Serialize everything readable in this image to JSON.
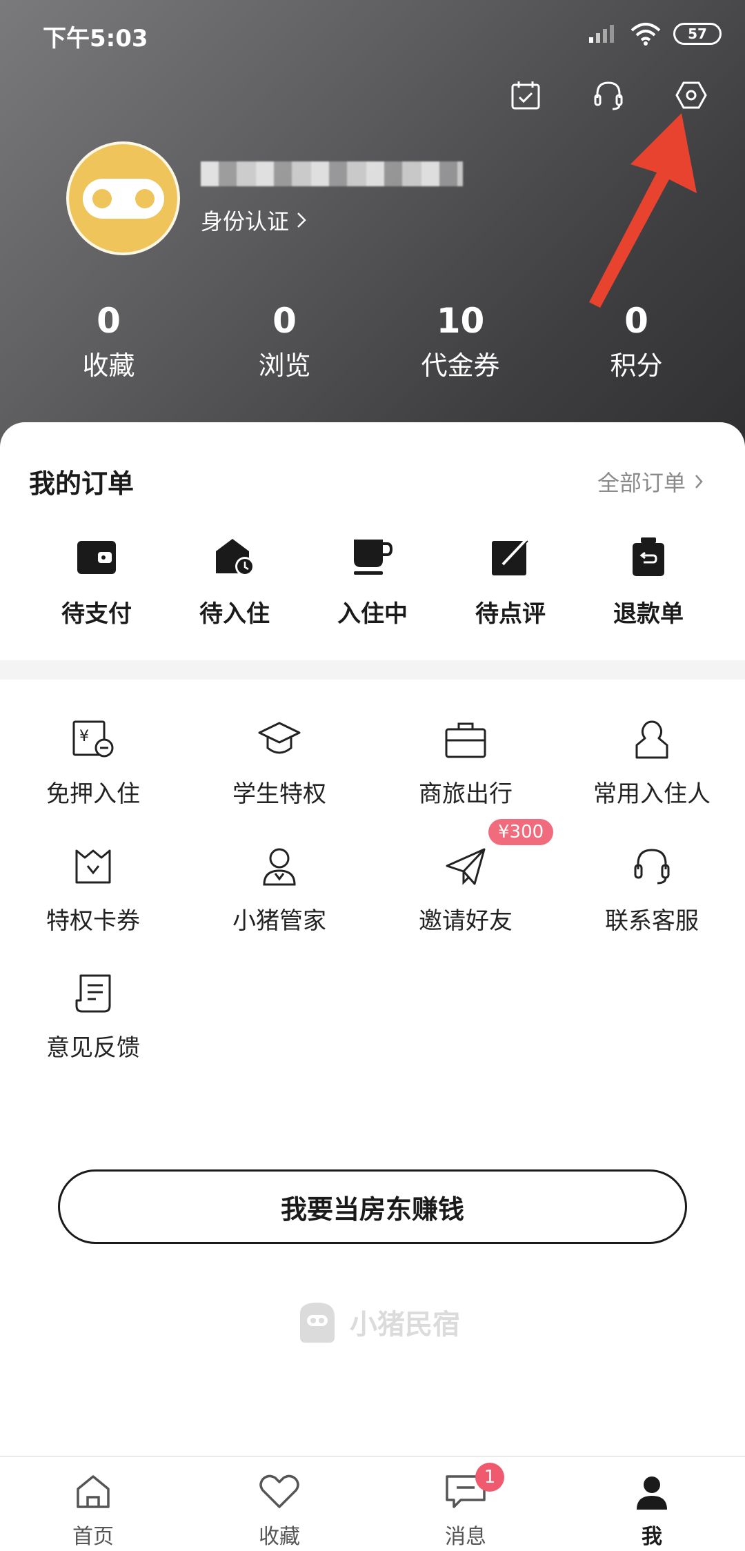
{
  "status_bar": {
    "time": "下午5:03",
    "battery": "57"
  },
  "header": {
    "verify_label": "身份认证",
    "stats": [
      {
        "value": "0",
        "label": "收藏"
      },
      {
        "value": "0",
        "label": "浏览"
      },
      {
        "value": "10",
        "label": "代金券"
      },
      {
        "value": "0",
        "label": "积分"
      }
    ]
  },
  "orders": {
    "title": "我的订单",
    "all_label": "全部订单",
    "items": [
      {
        "label": "待支付",
        "icon": "wallet-icon"
      },
      {
        "label": "待入住",
        "icon": "house-clock-icon"
      },
      {
        "label": "入住中",
        "icon": "cup-icon"
      },
      {
        "label": "待点评",
        "icon": "edit-icon"
      },
      {
        "label": "退款单",
        "icon": "refund-icon"
      }
    ]
  },
  "services": {
    "items": [
      {
        "label": "免押入住",
        "icon": "deposit-free-icon"
      },
      {
        "label": "学生特权",
        "icon": "graduation-cap-icon"
      },
      {
        "label": "商旅出行",
        "icon": "briefcase-icon"
      },
      {
        "label": "常用入住人",
        "icon": "person-icon"
      },
      {
        "label": "特权卡券",
        "icon": "crown-card-icon"
      },
      {
        "label": "小猪管家",
        "icon": "butler-icon"
      },
      {
        "label": "邀请好友",
        "icon": "paper-plane-icon",
        "badge": "¥300"
      },
      {
        "label": "联系客服",
        "icon": "headset-icon"
      },
      {
        "label": "意见反馈",
        "icon": "feedback-icon"
      }
    ]
  },
  "landlord_button": "我要当房东赚钱",
  "brand": {
    "name": "小猪民宿"
  },
  "bottom_nav": {
    "items": [
      {
        "label": "首页",
        "icon": "home-icon"
      },
      {
        "label": "收藏",
        "icon": "heart-icon"
      },
      {
        "label": "消息",
        "icon": "message-icon",
        "badge": "1"
      },
      {
        "label": "我",
        "icon": "profile-icon",
        "active": true
      }
    ]
  },
  "colors": {
    "header_dark": "#3e3e40",
    "avatar_yellow": "#efc55b",
    "badge_red": "#ef5a6f",
    "annotation_red": "#e8432f"
  }
}
